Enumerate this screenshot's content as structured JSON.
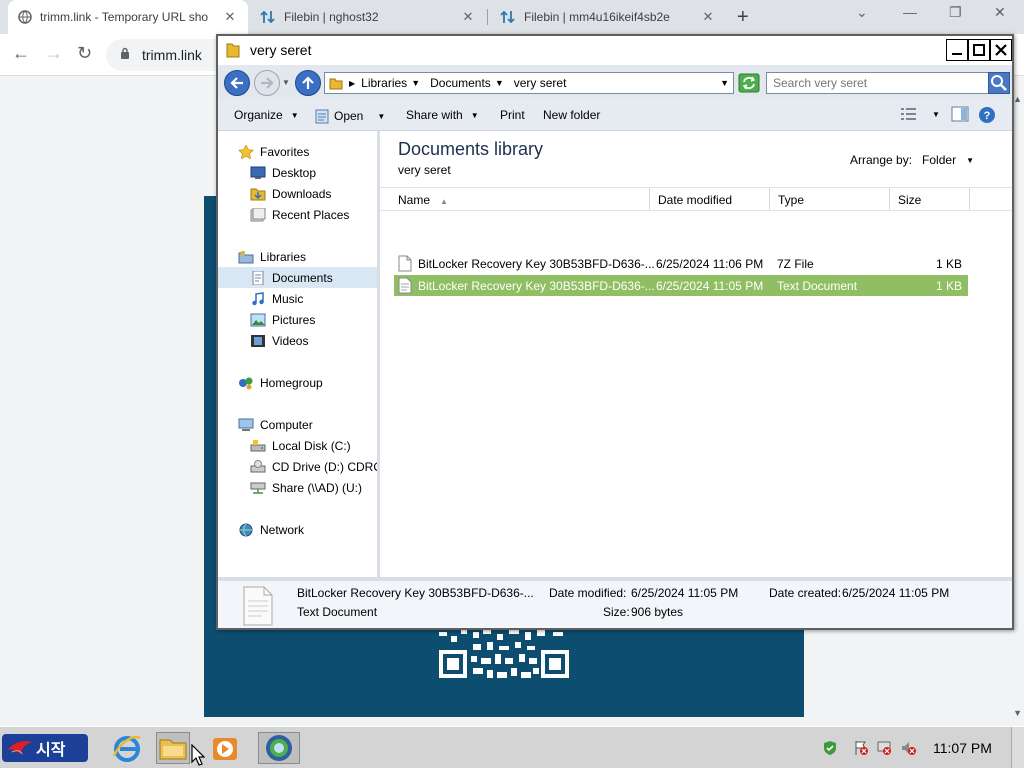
{
  "browser": {
    "tabs": [
      {
        "title": "trimm.link - Temporary URL sho",
        "active": true
      },
      {
        "title": "Filebin | nghost32",
        "active": false
      },
      {
        "title": "Filebin | mm4u16ikeif4sb2e",
        "active": false
      }
    ],
    "new_tab": "+",
    "address": "trimm.link"
  },
  "explorer": {
    "window_title": "very seret",
    "breadcrumbs": [
      "Libraries",
      "Documents",
      "very seret"
    ],
    "search_placeholder": "Search very seret",
    "commands": {
      "organize": "Organize",
      "open": "Open",
      "share_with": "Share with",
      "print": "Print",
      "new_folder": "New folder"
    },
    "nav": {
      "favorites": "Favorites",
      "desktop": "Desktop",
      "downloads": "Downloads",
      "recent_places": "Recent Places",
      "libraries": "Libraries",
      "documents": "Documents",
      "music": "Music",
      "pictures": "Pictures",
      "videos": "Videos",
      "homegroup": "Homegroup",
      "computer": "Computer",
      "local_disk": "Local Disk (C:)",
      "cd_drive": "CD Drive (D:) CDROM",
      "share": "Share (\\\\AD) (U:)",
      "network": "Network"
    },
    "library": {
      "title": "Documents library",
      "subtitle": "very seret",
      "arrange_label": "Arrange by:",
      "arrange_value": "Folder"
    },
    "columns": {
      "name": "Name",
      "date_modified": "Date modified",
      "type": "Type",
      "size": "Size"
    },
    "files": [
      {
        "name": "BitLocker Recovery Key 30B53BFD-D636-...",
        "date": "6/25/2024 11:06 PM",
        "type": "7Z File",
        "size": "1 KB"
      },
      {
        "name": "BitLocker Recovery Key 30B53BFD-D636-...",
        "date": "6/25/2024 11:05 PM",
        "type": "Text Document",
        "size": "1 KB"
      }
    ],
    "details": {
      "name": "BitLocker Recovery Key 30B53BFD-D636-...",
      "type": "Text Document",
      "date_modified_label": "Date modified:",
      "date_modified": "6/25/2024 11:05 PM",
      "date_created_label": "Date created:",
      "date_created": "6/25/2024 11:05 PM",
      "size_label": "Size:",
      "size": "906 bytes"
    }
  },
  "taskbar": {
    "start_label": "시작",
    "clock": "11:07 PM"
  },
  "colors": {
    "selection": "#8fbf62",
    "page_panel": "#0d4d70"
  }
}
